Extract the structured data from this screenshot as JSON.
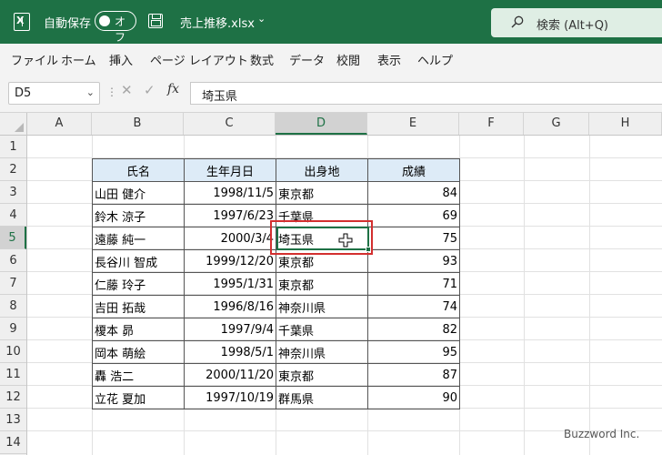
{
  "titlebar": {
    "autosave_label": "自動保存",
    "toggle_label": "オフ",
    "filename": "売上推移.xlsx",
    "search_label": "検索 (Alt+Q)"
  },
  "menu": [
    "ファイル",
    "ホーム",
    "挿入",
    "ページ レイアウト",
    "数式",
    "データ",
    "校閲",
    "表示",
    "ヘルプ"
  ],
  "formula_bar": {
    "name_box": "D5",
    "fx": "fx",
    "value": "埼玉県"
  },
  "columns": [
    "A",
    "B",
    "C",
    "D",
    "E",
    "F",
    "G",
    "H"
  ],
  "rows": [
    "1",
    "2",
    "3",
    "4",
    "5",
    "6",
    "7",
    "8",
    "9",
    "10",
    "11",
    "12",
    "13",
    "14"
  ],
  "table": {
    "headers": [
      "氏名",
      "生年月日",
      "出身地",
      "成績"
    ],
    "rows": [
      [
        "山田 健介",
        "1998/11/5",
        "東京都",
        "84"
      ],
      [
        "鈴木 涼子",
        "1997/6/23",
        "千葉県",
        "69"
      ],
      [
        "遠藤 純一",
        "2000/3/4",
        "埼玉県",
        "75"
      ],
      [
        "長谷川 智成",
        "1999/12/20",
        "東京都",
        "93"
      ],
      [
        "仁藤 玲子",
        "1995/1/31",
        "東京都",
        "71"
      ],
      [
        "吉田 拓哉",
        "1996/8/16",
        "神奈川県",
        "74"
      ],
      [
        "榎本 昴",
        "1997/9/4",
        "千葉県",
        "82"
      ],
      [
        "岡本 萌絵",
        "1998/5/1",
        "神奈川県",
        "95"
      ],
      [
        "轟 浩二",
        "2000/11/20",
        "東京都",
        "87"
      ],
      [
        "立花 夏加",
        "1997/10/19",
        "群馬県",
        "90"
      ]
    ]
  },
  "watermark": "Buzzword Inc.",
  "colors": {
    "brand": "#1e7145",
    "selection": "#d32f2f",
    "header_fill": "#ddebf7"
  }
}
